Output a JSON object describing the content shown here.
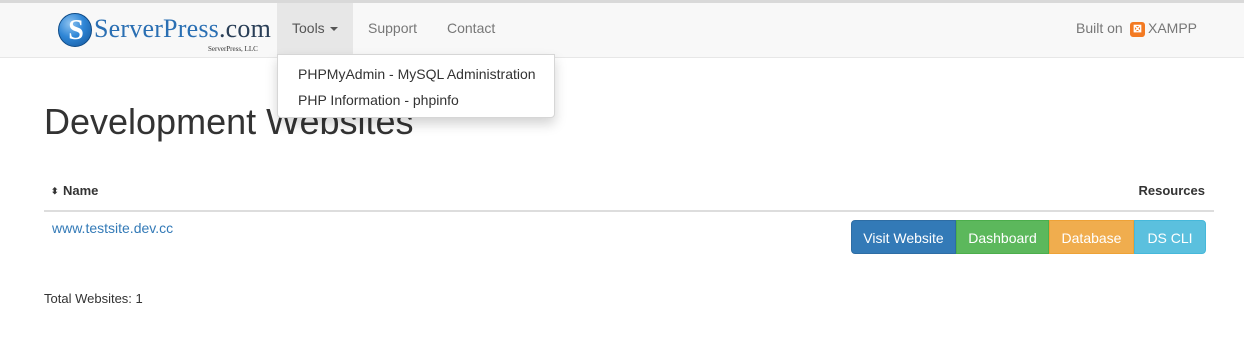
{
  "brand": {
    "logo_letter": "S",
    "name_main": "ServerPress",
    "name_suffix": ".com",
    "subtitle": "ServerPress, LLC"
  },
  "nav": {
    "tools_label": "Tools",
    "support_label": "Support",
    "contact_label": "Contact",
    "built_on_label": "Built on",
    "xampp_icon_glyph": "⊠",
    "xampp_label": "XAMPP"
  },
  "dropdown": {
    "items": [
      {
        "label": "PHPMyAdmin - MySQL Administration"
      },
      {
        "label": "PHP Information - phpinfo"
      }
    ]
  },
  "main": {
    "title": "Development Websites",
    "table": {
      "sort_glyph": "⬍",
      "col_name": "Name",
      "col_resources": "Resources",
      "rows": [
        {
          "site": "www.testsite.dev.cc",
          "buttons": {
            "visit": "Visit Website",
            "dashboard": "Dashboard",
            "database": "Database",
            "cli": "DS CLI"
          }
        }
      ]
    },
    "total": "Total Websites: 1"
  },
  "colors": {
    "primary": "#337ab7",
    "success": "#5cb85c",
    "warning": "#f0ad4e",
    "info": "#5bc0de",
    "xampp_orange": "#f37a22"
  },
  "icons": {
    "sort": "sort-icon",
    "caret": "caret-down-icon",
    "xampp": "xampp-logo-icon",
    "brand": "serverpress-logo-icon"
  }
}
